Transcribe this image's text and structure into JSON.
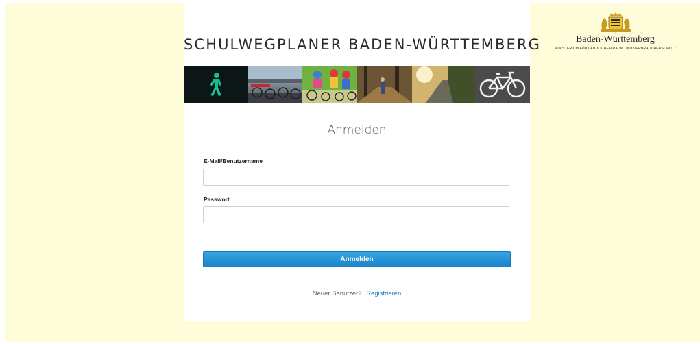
{
  "header": {
    "title": "SCHULWEGPLANER BADEN-WÜRTTEMBERG"
  },
  "banner": {
    "images": [
      "pedestrian-traffic-light",
      "parked-bicycles",
      "children-cycling",
      "autumn-path",
      "sunlit-road",
      "bicycle-road-marking"
    ]
  },
  "login": {
    "heading": "Anmelden",
    "username": {
      "label": "E-Mail/Benutzername",
      "value": "",
      "placeholder": ""
    },
    "password": {
      "label": "Passwort",
      "value": "",
      "placeholder": ""
    },
    "submit_label": "Anmelden",
    "register_prompt": "Neuer Benutzer?",
    "register_link": "Registrieren"
  },
  "brand": {
    "name": "Baden-Württemberg",
    "ministry": "MINISTERIUM FÜR LÄNDLICHEN RAUM UND VERBRAUCHERSCHUTZ",
    "crest_icon": "state-coat-of-arms-icon"
  },
  "colors": {
    "page_background": "#fefcd9",
    "panel_background": "#ffffff",
    "button_primary": "#1c84c9",
    "link": "#1f7cc0"
  }
}
